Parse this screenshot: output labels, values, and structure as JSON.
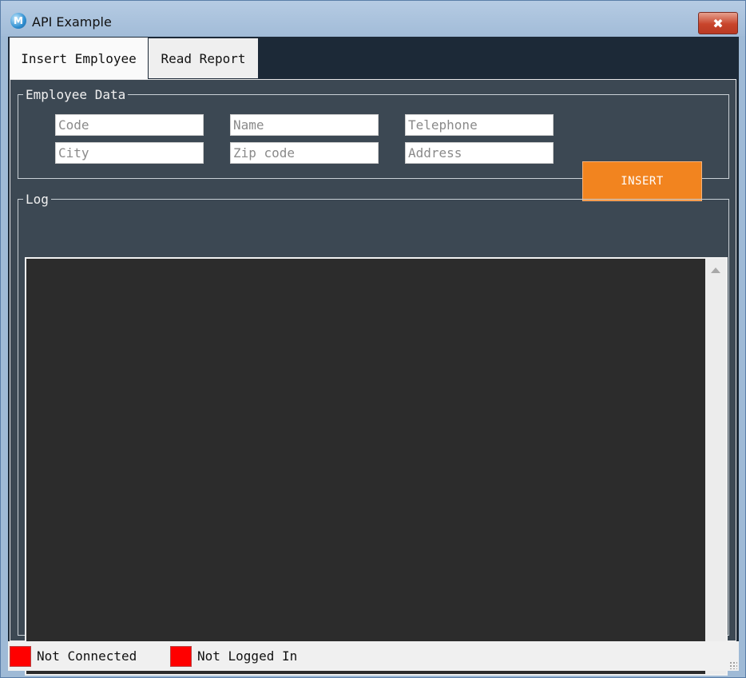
{
  "window": {
    "title": "API Example",
    "close_symbol": "✖",
    "app_icon_glyph": "M"
  },
  "tabs": [
    {
      "label": "Insert Employee",
      "active": true
    },
    {
      "label": "Read Report",
      "active": false
    }
  ],
  "employee_data": {
    "legend": "Employee Data",
    "fields": {
      "code": {
        "placeholder": "Code",
        "value": ""
      },
      "name": {
        "placeholder": "Name",
        "value": ""
      },
      "telephone": {
        "placeholder": "Telephone",
        "value": ""
      },
      "city": {
        "placeholder": "City",
        "value": ""
      },
      "zip_code": {
        "placeholder": "Zip code",
        "value": ""
      },
      "address": {
        "placeholder": "Address",
        "value": ""
      }
    },
    "insert_label": "INSERT"
  },
  "log": {
    "legend": "Log",
    "content": ""
  },
  "status": {
    "connection": "Not Connected",
    "login": "Not Logged In"
  },
  "colors": {
    "accent": "#f2841f",
    "status_error": "#ff0000",
    "panel": "#3c4853",
    "log_bg": "#2c2c2c"
  },
  "icons": {
    "app": "app-logo-icon",
    "close": "close-icon",
    "scroll_up": "scroll-up-arrow-icon",
    "scroll_down": "scroll-down-arrow-icon",
    "resize": "resize-grip-icon"
  }
}
